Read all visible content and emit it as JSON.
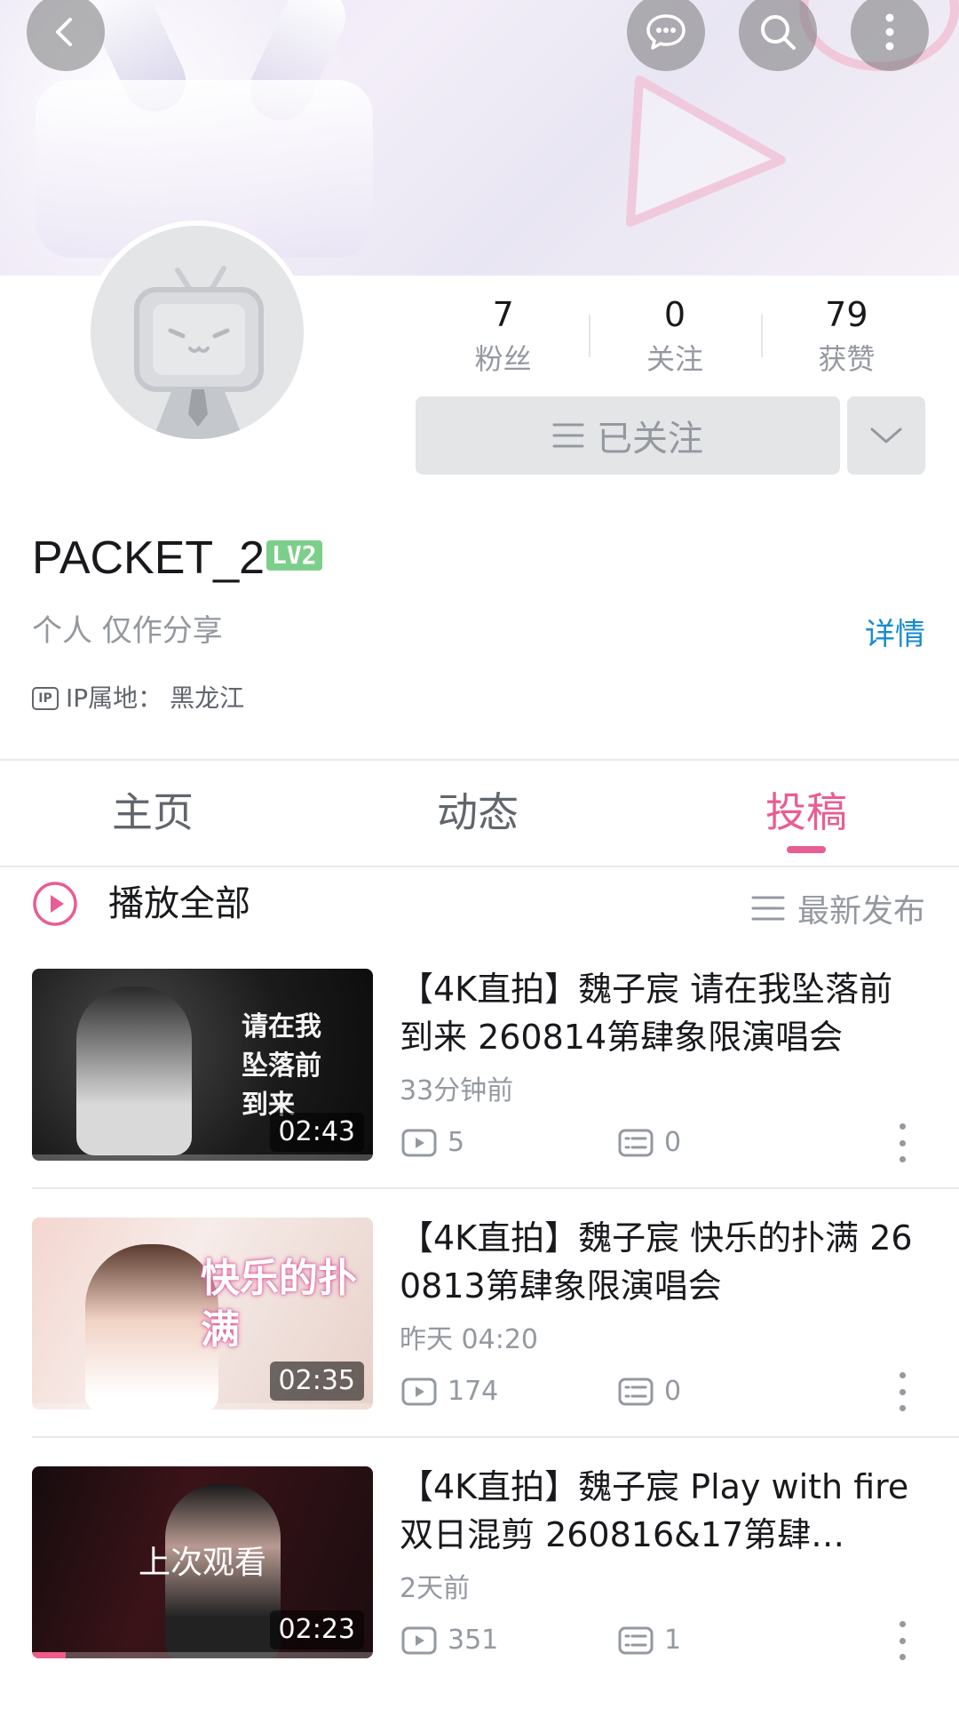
{
  "header": {
    "back_icon": "chevron-left-icon",
    "actions": [
      "chat-icon",
      "search-icon",
      "more-vertical-icon"
    ]
  },
  "profile": {
    "avatar_icon": "default-tv-avatar-icon",
    "stats": [
      {
        "value": "7",
        "label": "粉丝"
      },
      {
        "value": "0",
        "label": "关注"
      },
      {
        "value": "79",
        "label": "获赞"
      }
    ],
    "follow_button": "已关注",
    "username": "PACKET_2",
    "level": "LV2",
    "sign": "个人 仅作分享",
    "detail_link": "详情",
    "ip_label": "IP属地：",
    "ip_value": "黑龙江"
  },
  "tabs": [
    {
      "label": "主页",
      "active": false
    },
    {
      "label": "动态",
      "active": false
    },
    {
      "label": "投稿",
      "active": true
    }
  ],
  "toolbar": {
    "play_all": "播放全部",
    "sort": "最新发布"
  },
  "videos": [
    {
      "title": "【4K直拍】魏子宸 请在我坠落前到来 260814第肆象限演唱会",
      "time": "33分钟前",
      "plays": "5",
      "comments": "0",
      "duration": "02:43",
      "thumb_text": "请在我坠落前到来",
      "watched_progress": 0
    },
    {
      "title": "【4K直拍】魏子宸 快乐的扑满 260813第肆象限演唱会",
      "time": "昨天 04:20",
      "plays": "174",
      "comments": "0",
      "duration": "02:35",
      "thumb_text": "快乐的扑满",
      "watched_progress": 0
    },
    {
      "title": "【4K直拍】魏子宸 Play with fire 双日混剪 260816&17第肆…",
      "time": "2天前",
      "plays": "351",
      "comments": "1",
      "duration": "02:23",
      "overlay": "上次观看",
      "watched_progress": 0.1
    }
  ],
  "colors": {
    "accent_pink": "#e85d94",
    "link_blue": "#178bcf",
    "level_green": "#7ccf8a",
    "muted_gray": "#9499a0"
  }
}
